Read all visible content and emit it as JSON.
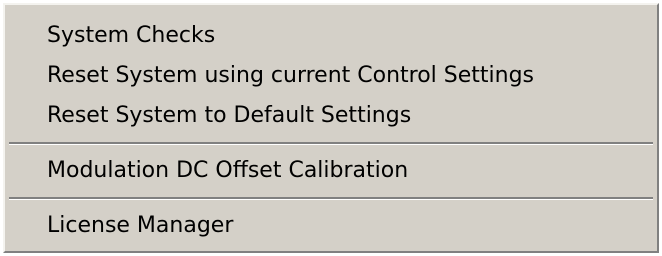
{
  "menu": {
    "items": [
      {
        "label": "System Checks"
      },
      {
        "label": "Reset System using current Control Settings"
      },
      {
        "label": "Reset System to Default Settings"
      },
      {
        "label": "Modulation DC Offset Calibration"
      },
      {
        "label": "License Manager"
      }
    ]
  }
}
